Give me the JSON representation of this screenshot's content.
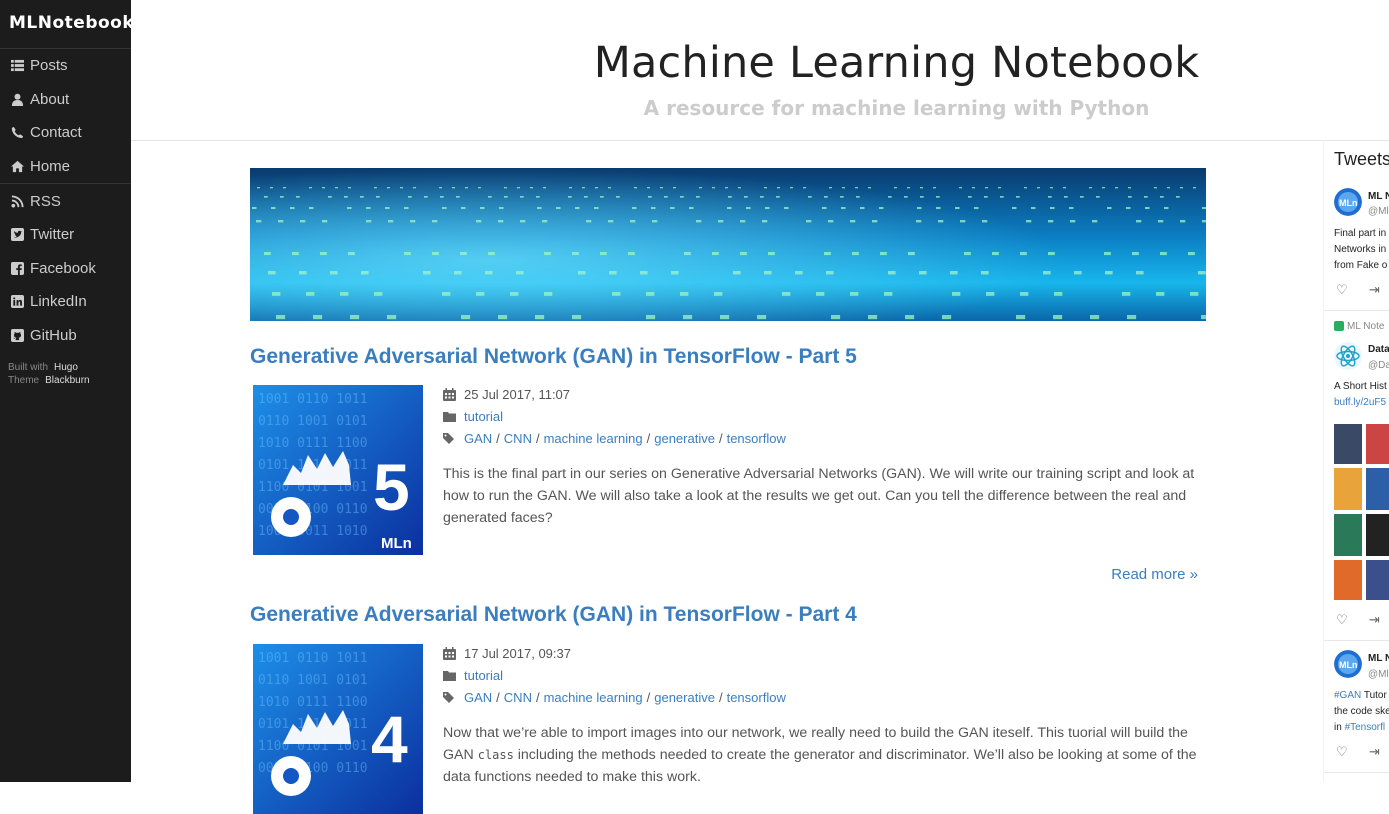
{
  "sidebar": {
    "brand": "MLNotebook",
    "items": [
      {
        "label": "Posts",
        "icon": "list-icon"
      },
      {
        "label": "About",
        "icon": "user-icon"
      },
      {
        "label": "Contact",
        "icon": "phone-icon"
      },
      {
        "label": "Home",
        "icon": "home-icon"
      }
    ],
    "social": [
      {
        "label": "RSS",
        "icon": "rss-icon"
      },
      {
        "label": "Twitter",
        "icon": "twitter-icon"
      },
      {
        "label": "Facebook",
        "icon": "facebook-icon"
      },
      {
        "label": "LinkedIn",
        "icon": "linkedin-icon"
      },
      {
        "label": "GitHub",
        "icon": "github-icon"
      }
    ],
    "built_with": "Built with",
    "hugo": "Hugo",
    "theme": "Theme",
    "blackburn": "Blackburn"
  },
  "header": {
    "title": "Machine Learning Notebook",
    "subtitle": "A resource for machine learning with Python"
  },
  "posts": [
    {
      "title": "Generative Adversarial Network (GAN) in TensorFlow - Part 5",
      "thumb_number": "5",
      "thumb_brand": "MLn",
      "date": "25 Jul 2017, 11:07",
      "category": "tutorial",
      "tags": [
        "GAN",
        "CNN",
        "machine learning",
        "generative",
        "tensorflow"
      ],
      "excerpt": "This is the final part in our series on Generative Adversarial Networks (GAN). We will write our training script and look at how to run the GAN. We will also take a look at the results we get out. Can you tell the difference between the real and generated faces?",
      "read_more": "Read more »"
    },
    {
      "title": "Generative Adversarial Network (GAN) in TensorFlow - Part 4",
      "thumb_number": "4",
      "date": "17 Jul 2017, 09:37",
      "category": "tutorial",
      "tags": [
        "GAN",
        "CNN",
        "machine learning",
        "generative",
        "tensorflow"
      ],
      "excerpt_a": "Now that we’re able to import images into our network, we really need to build the GAN iteself. This tuorial will build the GAN ",
      "excerpt_code": "class",
      "excerpt_b": " including the methods needed to create the generator and discriminator. We’ll also be looking at some of the data functions needed to make this work."
    }
  ],
  "tweets": {
    "title": "Tweets",
    "t1": {
      "name": "ML N",
      "handle": "@Ml",
      "avatar": "MLn",
      "lines": [
        "Final part in",
        "Networks in",
        "from Fake o"
      ]
    },
    "t2": {
      "retweet": "ML Note",
      "name": "Data",
      "handle": "@Da",
      "lines": [
        "A Short Hist"
      ],
      "link": "buff.ly/2uF5"
    },
    "t3": {
      "name": "ML N",
      "handle": "@Ml",
      "avatar": "MLn",
      "lines_link": "#GAN",
      "l1": " Tutor",
      "l2": "the code ske",
      "l3a": "in ",
      "l3link": "#Tensorfl"
    }
  },
  "colors": {
    "accent": "#3a7ebf",
    "sidebar_bg": "#1c1c1c"
  }
}
